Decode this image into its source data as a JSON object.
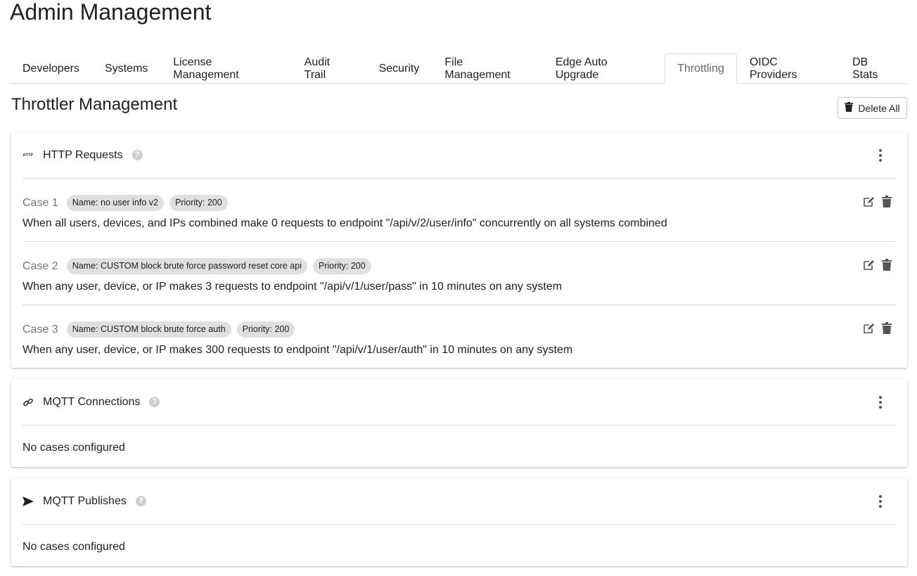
{
  "page": {
    "title": "Admin Management"
  },
  "tabs": [
    {
      "label": "Developers",
      "active": false
    },
    {
      "label": "Systems",
      "active": false
    },
    {
      "label": "License Management",
      "active": false
    },
    {
      "label": "Audit Trail",
      "active": false
    },
    {
      "label": "Security",
      "active": false
    },
    {
      "label": "File Management",
      "active": false
    },
    {
      "label": "Edge Auto Upgrade",
      "active": false
    },
    {
      "label": "Throttling",
      "active": true
    },
    {
      "label": "OIDC Providers",
      "active": false
    },
    {
      "label": "DB Stats",
      "active": false
    }
  ],
  "section": {
    "title": "Throttler Management",
    "delete_all_label": "Delete All"
  },
  "cards": [
    {
      "title": "HTTP Requests",
      "icon": "http-icon",
      "icon_text": "HTTP",
      "cases": [
        {
          "label": "Case 1",
          "name_chip": "Name: no user info v2",
          "priority_chip": "Priority: 200",
          "description": "When all users, devices, and IPs combined make 0 requests to endpoint \"/api/v/2/user/info\" concurrently on all systems combined"
        },
        {
          "label": "Case 2",
          "name_chip": "Name: CUSTOM block brute force password reset core api",
          "priority_chip": "Priority: 200",
          "description": "When any user, device, or IP makes 3 requests to endpoint \"/api/v/1/user/pass\" in 10 minutes on any system"
        },
        {
          "label": "Case 3",
          "name_chip": "Name: CUSTOM block brute force auth",
          "priority_chip": "Priority: 200",
          "description": "When any user, device, or IP makes 300 requests to endpoint \"/api/v/1/user/auth\" in 10 minutes on any system"
        }
      ]
    },
    {
      "title": "MQTT Connections",
      "icon": "link-icon",
      "empty_text": "No cases configured"
    },
    {
      "title": "MQTT Publishes",
      "icon": "send-icon",
      "empty_text": "No cases configured"
    }
  ],
  "icons": {
    "help": "?"
  },
  "colors": {
    "chip_bg": "#e0e0e0",
    "muted_text": "#757575",
    "icon_gray": "#555555"
  }
}
